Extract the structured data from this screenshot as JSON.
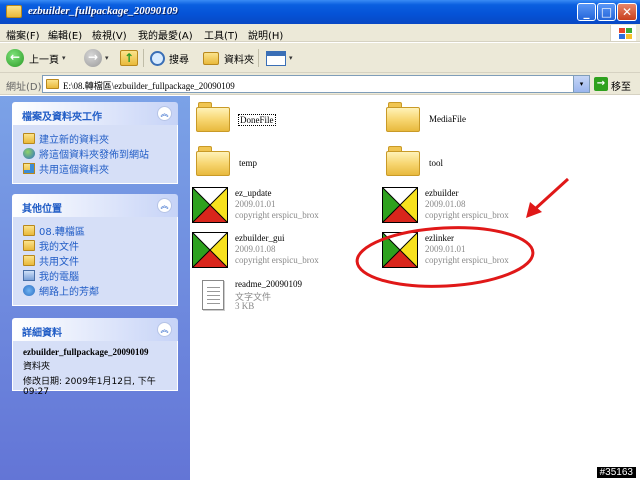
{
  "window": {
    "title": "ezbuilder_fullpackage_20090109",
    "min_glyph": "_",
    "max_glyph": "□",
    "close_glyph": "✕"
  },
  "menu": [
    "檔案(F)",
    "編輯(E)",
    "檢視(V)",
    "我的最愛(A)",
    "工具(T)",
    "說明(H)"
  ],
  "toolbar": {
    "back_label": "上一頁",
    "back_glyph": "←",
    "forward_glyph": "→",
    "up_glyph": "↑",
    "search_label": "搜尋",
    "folders_label": "資料夾",
    "dropdown_glyph": "▾"
  },
  "address": {
    "label": "網址(D)",
    "value": "E:\\08.轉檔區\\ezbuilder_fullpackage_20090109",
    "go_label": "移至",
    "go_glyph": "→"
  },
  "left_pane": {
    "tasks": {
      "title": "檔案及資料夾工作",
      "chevron": "︽",
      "items": [
        {
          "label": "建立新的資料夾",
          "icon": "new-folder-icon"
        },
        {
          "label": "將這個資料夾發佈到網站",
          "icon": "publish-web-icon"
        },
        {
          "label": "共用這個資料夾",
          "icon": "share-folder-icon"
        }
      ]
    },
    "other_places": {
      "title": "其他位置",
      "chevron": "︽",
      "items": [
        {
          "label": "08.轉檔區",
          "icon": "folder-icon"
        },
        {
          "label": "我的文件",
          "icon": "my-documents-icon"
        },
        {
          "label": "共用文件",
          "icon": "shared-documents-icon"
        },
        {
          "label": "我的電腦",
          "icon": "my-computer-icon"
        },
        {
          "label": "網路上的芳鄰",
          "icon": "network-places-icon"
        }
      ]
    },
    "details": {
      "title": "詳細資料",
      "chevron": "︽",
      "name": "ezbuilder_fullpackage_20090109",
      "type": "資料夾",
      "modified_line1": "修改日期: 2009年1月12日, 下午",
      "modified_line2": "09:27"
    }
  },
  "files": [
    {
      "kind": "folder",
      "name": "DoneFile",
      "selected": true
    },
    {
      "kind": "folder",
      "name": "MediaFile"
    },
    {
      "kind": "folder",
      "name": "temp"
    },
    {
      "kind": "folder",
      "name": "tool"
    },
    {
      "kind": "app",
      "name": "ez_update",
      "line2": "2009.01.01",
      "line3": "copyright erspicu_brox"
    },
    {
      "kind": "app",
      "name": "ezbuilder",
      "line2": "2009.01.08",
      "line3": "copyright erspicu_brox"
    },
    {
      "kind": "app",
      "name": "ezbuilder_gui",
      "line2": "2009.01.08",
      "line3": "copyright erspicu_brox"
    },
    {
      "kind": "app",
      "name": "ezlinker",
      "line2": "2009.01.01",
      "line3": "copyright erspicu_brox"
    },
    {
      "kind": "doc",
      "name": "readme_20090109",
      "line2": "文字文件",
      "line3": "3 KB"
    }
  ],
  "annotation": {
    "color": "#e01818"
  },
  "watermark": "#35163"
}
